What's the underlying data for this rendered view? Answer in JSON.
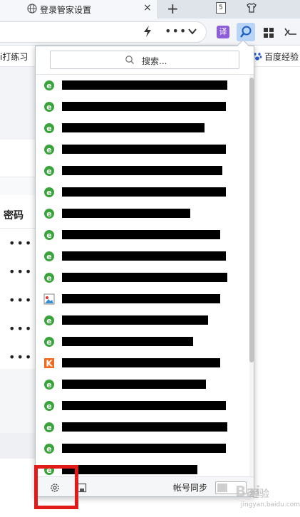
{
  "browser": {
    "tab_left_text": "",
    "tab_title": "登录管家设置",
    "tab_close": "×",
    "new_tab": "+",
    "tab_count": "5",
    "window_min": "—"
  },
  "toolbar": {
    "more": "•••",
    "translate_label": "译"
  },
  "bookmarks": {
    "left_text": "i打练习",
    "right_text": "百度经验"
  },
  "page": {
    "password_header": "密码",
    "password_dots": [
      "•••",
      "•••",
      "•••",
      "•••",
      "•••"
    ]
  },
  "popup": {
    "search_placeholder": "搜索...",
    "items": [
      {
        "icon": "ie-icon",
        "redact_width": 232,
        "label": ""
      },
      {
        "icon": "ie-icon",
        "redact_width": 230,
        "label": ""
      },
      {
        "icon": "ie-icon",
        "redact_width": 200,
        "label": ""
      },
      {
        "icon": "ie-icon",
        "redact_width": 230,
        "label": ""
      },
      {
        "icon": "ie-icon",
        "redact_width": 225,
        "label": ""
      },
      {
        "icon": "ie-icon",
        "redact_width": 230,
        "label": ""
      },
      {
        "icon": "ie-icon",
        "redact_width": 180,
        "label": ""
      },
      {
        "icon": "ie-icon",
        "redact_width": 222,
        "label": ""
      },
      {
        "icon": "ie-icon",
        "redact_width": 230,
        "label": ""
      },
      {
        "icon": "ie-icon",
        "redact_width": 232,
        "label": ""
      },
      {
        "icon": "photo-icon",
        "redact_width": 222,
        "label": ""
      },
      {
        "icon": "ie-icon",
        "redact_width": 205,
        "label": ""
      },
      {
        "icon": "ie-icon",
        "redact_width": 184,
        "label": ""
      },
      {
        "icon": "k-icon",
        "redact_width": 222,
        "label": ""
      },
      {
        "icon": "ie-icon",
        "redact_width": 202,
        "label": ""
      },
      {
        "icon": "ie-icon",
        "redact_width": 230,
        "label": ""
      },
      {
        "icon": "ie-icon",
        "redact_width": 232,
        "label": ""
      },
      {
        "icon": "ie-icon",
        "redact_width": 230,
        "label": ""
      },
      {
        "icon": "ie-icon",
        "redact_width": 190,
        "label": ""
      }
    ],
    "footer": {
      "sync_label": "帐号同步"
    }
  },
  "watermark": {
    "text": "经验",
    "url": "jingyan.baidu.com"
  },
  "colors": {
    "highlight": "#e11a1a",
    "ie_green": "#3aa43c",
    "k_orange": "#f26a21",
    "translate_purple": "#8c5dd6",
    "search_blue_bg": "#b9d4f5"
  }
}
